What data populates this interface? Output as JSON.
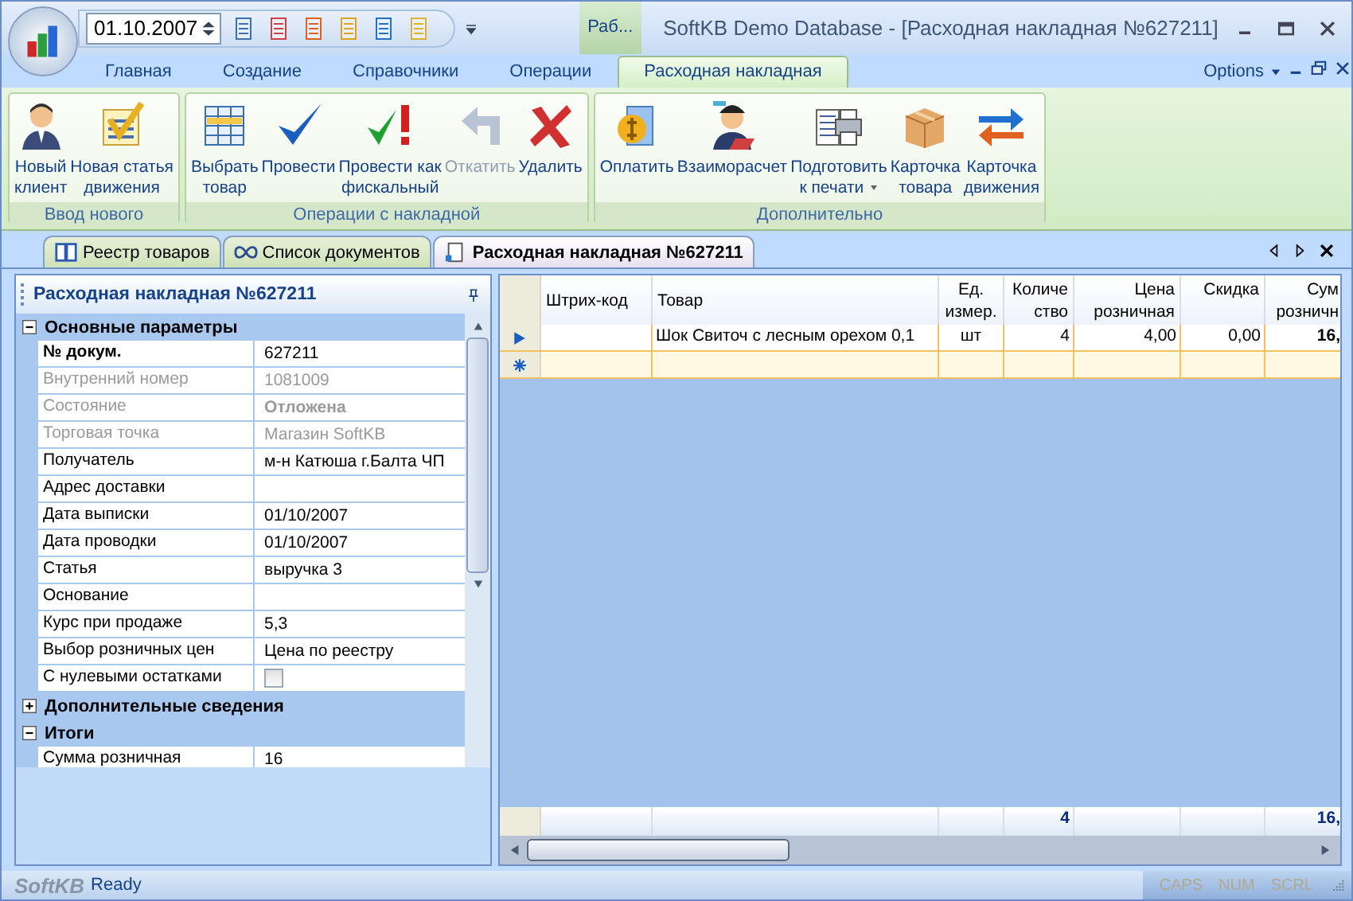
{
  "window": {
    "title": "SoftKB Demo Database - [Расходная накладная №627211]",
    "date": "01.10.2007",
    "minimized_tab": "Раб..."
  },
  "ribbon": {
    "tabs": [
      {
        "label": "Главная",
        "selected": false
      },
      {
        "label": "Создание",
        "selected": false
      },
      {
        "label": "Справочники",
        "selected": false
      },
      {
        "label": "Операции",
        "selected": false
      },
      {
        "label": "Расходная накладная",
        "selected": true
      }
    ],
    "options": "Options",
    "groups": [
      {
        "title": "Ввод нового",
        "buttons": [
          {
            "label": "Новый\nклиент",
            "disabled": false
          },
          {
            "label": "Новая статья\nдвижения",
            "disabled": false
          }
        ]
      },
      {
        "title": "Операции с накладной",
        "buttons": [
          {
            "label": "Выбрать\nтовар",
            "disabled": false
          },
          {
            "label": "Провести",
            "disabled": false
          },
          {
            "label": "Провести как\nфискальный",
            "disabled": false
          },
          {
            "label": "Откатить",
            "disabled": true
          },
          {
            "label": "Удалить",
            "disabled": false
          }
        ]
      },
      {
        "title": "Дополнительно",
        "buttons": [
          {
            "label": "Оплатить",
            "disabled": false
          },
          {
            "label": "Взаиморасчет",
            "disabled": false
          },
          {
            "label": "Подготовить\nк печати",
            "disabled": false,
            "dropdown": true
          },
          {
            "label": "Карточка\nтовара",
            "disabled": false
          },
          {
            "label": "Карточка\nдвижения",
            "disabled": false
          }
        ]
      }
    ]
  },
  "doc_tabs": [
    {
      "label": "Реестр товаров",
      "selected": false
    },
    {
      "label": "Список документов",
      "selected": false
    },
    {
      "label": "Расходная накладная №627211",
      "selected": true
    }
  ],
  "panel": {
    "title": "Расходная накладная №627211",
    "sections": [
      {
        "title": "Основные параметры",
        "expanded": true,
        "rows": [
          {
            "kind": "text",
            "label": "№ докум.",
            "value": "627211",
            "label_bold": true,
            "disabled": false
          },
          {
            "kind": "text",
            "label": "Внутренний номер",
            "value": "1081009",
            "disabled": true
          },
          {
            "kind": "text",
            "label": "Состояние",
            "value": "Отложена",
            "value_bold": true,
            "disabled": true
          },
          {
            "kind": "text",
            "label": "Торговая точка",
            "value": "Магазин SoftKB",
            "disabled": true
          },
          {
            "kind": "text",
            "label": "Получатель",
            "value": "м-н Катюша г.Балта ЧП",
            "disabled": false
          },
          {
            "kind": "text",
            "label": "Адрес доставки",
            "disabled": false
          },
          {
            "kind": "text",
            "label": "Дата выписки",
            "value": "01/10/2007",
            "disabled": false
          },
          {
            "kind": "text",
            "label": "Дата проводки",
            "value": "01/10/2007",
            "disabled": false
          },
          {
            "kind": "text",
            "label": "Статья",
            "value": "выручка 3",
            "disabled": false
          },
          {
            "kind": "text",
            "label": "Основание",
            "disabled": false
          },
          {
            "kind": "text",
            "label": "Курс при продаже",
            "value": "5,3",
            "disabled": false
          },
          {
            "kind": "text",
            "label": "Выбор розничных цен",
            "value": "Цена по реестру",
            "disabled": false
          },
          {
            "kind": "checkbox",
            "label": "С нулевыми остатками",
            "checked": false,
            "disabled": false
          }
        ]
      },
      {
        "title": "Дополнительные сведения",
        "expanded": false
      },
      {
        "title": "Итоги",
        "expanded": true,
        "rows": [
          {
            "kind": "text",
            "label": "Сумма розничная",
            "value": "16",
            "disabled": false
          }
        ]
      }
    ]
  },
  "grid": {
    "columns": [
      {
        "label": "Штрих-код"
      },
      {
        "label": "Товар"
      },
      {
        "label": "Ед.\nизмер."
      },
      {
        "label": "Количе\nство",
        "total": "4"
      },
      {
        "label": "Цена\nрозничная"
      },
      {
        "label": "Скидка"
      },
      {
        "label": "Сум\nрозничн",
        "total": "16,"
      }
    ],
    "rows": [
      {
        "current": true,
        "cells": [
          null,
          "Шок Свиточ с лесным орехом 0,1",
          "шт",
          "4",
          "4,00",
          "0,00",
          "16,"
        ]
      }
    ]
  },
  "status_bar": {
    "brand": "SoftKB",
    "text": "Ready",
    "indicators": [
      {
        "label": "CAPS",
        "on": false
      },
      {
        "label": "NUM",
        "on": false
      },
      {
        "label": "SCRL",
        "on": false
      }
    ]
  }
}
